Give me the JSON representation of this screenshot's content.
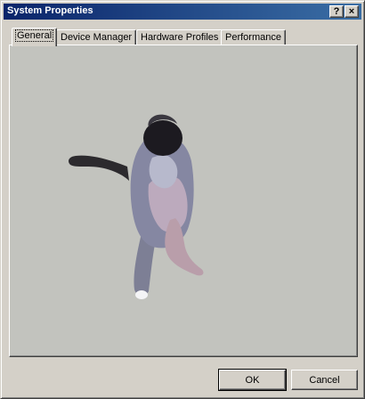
{
  "window": {
    "title": "System Properties",
    "help_label": "?",
    "close_label": "×"
  },
  "tabs": [
    {
      "label": "General",
      "active": true
    },
    {
      "label": "Device Manager",
      "active": false
    },
    {
      "label": "Hardware Profiles",
      "active": false
    },
    {
      "label": "Performance",
      "active": false
    }
  ],
  "buttons": {
    "ok": "OK",
    "cancel": "Cancel"
  },
  "colors": {
    "titlebar_start": "#0a246a",
    "titlebar_end": "#3a6ea5",
    "face": "#d4d0c8",
    "panel": "#c2c3be"
  },
  "content": {
    "image": "cat-standing-on-hind-legs"
  }
}
